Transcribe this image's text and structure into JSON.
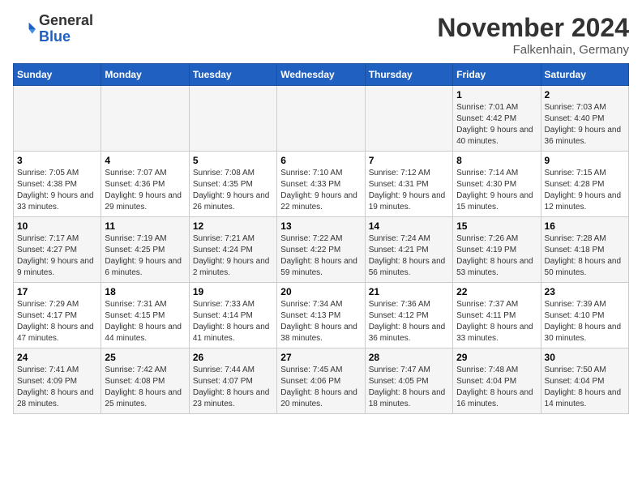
{
  "header": {
    "logo_general": "General",
    "logo_blue": "Blue",
    "month_title": "November 2024",
    "subtitle": "Falkenhain, Germany"
  },
  "columns": [
    "Sunday",
    "Monday",
    "Tuesday",
    "Wednesday",
    "Thursday",
    "Friday",
    "Saturday"
  ],
  "weeks": [
    [
      {
        "day": "",
        "info": ""
      },
      {
        "day": "",
        "info": ""
      },
      {
        "day": "",
        "info": ""
      },
      {
        "day": "",
        "info": ""
      },
      {
        "day": "",
        "info": ""
      },
      {
        "day": "1",
        "info": "Sunrise: 7:01 AM\nSunset: 4:42 PM\nDaylight: 9 hours and 40 minutes."
      },
      {
        "day": "2",
        "info": "Sunrise: 7:03 AM\nSunset: 4:40 PM\nDaylight: 9 hours and 36 minutes."
      }
    ],
    [
      {
        "day": "3",
        "info": "Sunrise: 7:05 AM\nSunset: 4:38 PM\nDaylight: 9 hours and 33 minutes."
      },
      {
        "day": "4",
        "info": "Sunrise: 7:07 AM\nSunset: 4:36 PM\nDaylight: 9 hours and 29 minutes."
      },
      {
        "day": "5",
        "info": "Sunrise: 7:08 AM\nSunset: 4:35 PM\nDaylight: 9 hours and 26 minutes."
      },
      {
        "day": "6",
        "info": "Sunrise: 7:10 AM\nSunset: 4:33 PM\nDaylight: 9 hours and 22 minutes."
      },
      {
        "day": "7",
        "info": "Sunrise: 7:12 AM\nSunset: 4:31 PM\nDaylight: 9 hours and 19 minutes."
      },
      {
        "day": "8",
        "info": "Sunrise: 7:14 AM\nSunset: 4:30 PM\nDaylight: 9 hours and 15 minutes."
      },
      {
        "day": "9",
        "info": "Sunrise: 7:15 AM\nSunset: 4:28 PM\nDaylight: 9 hours and 12 minutes."
      }
    ],
    [
      {
        "day": "10",
        "info": "Sunrise: 7:17 AM\nSunset: 4:27 PM\nDaylight: 9 hours and 9 minutes."
      },
      {
        "day": "11",
        "info": "Sunrise: 7:19 AM\nSunset: 4:25 PM\nDaylight: 9 hours and 6 minutes."
      },
      {
        "day": "12",
        "info": "Sunrise: 7:21 AM\nSunset: 4:24 PM\nDaylight: 9 hours and 2 minutes."
      },
      {
        "day": "13",
        "info": "Sunrise: 7:22 AM\nSunset: 4:22 PM\nDaylight: 8 hours and 59 minutes."
      },
      {
        "day": "14",
        "info": "Sunrise: 7:24 AM\nSunset: 4:21 PM\nDaylight: 8 hours and 56 minutes."
      },
      {
        "day": "15",
        "info": "Sunrise: 7:26 AM\nSunset: 4:19 PM\nDaylight: 8 hours and 53 minutes."
      },
      {
        "day": "16",
        "info": "Sunrise: 7:28 AM\nSunset: 4:18 PM\nDaylight: 8 hours and 50 minutes."
      }
    ],
    [
      {
        "day": "17",
        "info": "Sunrise: 7:29 AM\nSunset: 4:17 PM\nDaylight: 8 hours and 47 minutes."
      },
      {
        "day": "18",
        "info": "Sunrise: 7:31 AM\nSunset: 4:15 PM\nDaylight: 8 hours and 44 minutes."
      },
      {
        "day": "19",
        "info": "Sunrise: 7:33 AM\nSunset: 4:14 PM\nDaylight: 8 hours and 41 minutes."
      },
      {
        "day": "20",
        "info": "Sunrise: 7:34 AM\nSunset: 4:13 PM\nDaylight: 8 hours and 38 minutes."
      },
      {
        "day": "21",
        "info": "Sunrise: 7:36 AM\nSunset: 4:12 PM\nDaylight: 8 hours and 36 minutes."
      },
      {
        "day": "22",
        "info": "Sunrise: 7:37 AM\nSunset: 4:11 PM\nDaylight: 8 hours and 33 minutes."
      },
      {
        "day": "23",
        "info": "Sunrise: 7:39 AM\nSunset: 4:10 PM\nDaylight: 8 hours and 30 minutes."
      }
    ],
    [
      {
        "day": "24",
        "info": "Sunrise: 7:41 AM\nSunset: 4:09 PM\nDaylight: 8 hours and 28 minutes."
      },
      {
        "day": "25",
        "info": "Sunrise: 7:42 AM\nSunset: 4:08 PM\nDaylight: 8 hours and 25 minutes."
      },
      {
        "day": "26",
        "info": "Sunrise: 7:44 AM\nSunset: 4:07 PM\nDaylight: 8 hours and 23 minutes."
      },
      {
        "day": "27",
        "info": "Sunrise: 7:45 AM\nSunset: 4:06 PM\nDaylight: 8 hours and 20 minutes."
      },
      {
        "day": "28",
        "info": "Sunrise: 7:47 AM\nSunset: 4:05 PM\nDaylight: 8 hours and 18 minutes."
      },
      {
        "day": "29",
        "info": "Sunrise: 7:48 AM\nSunset: 4:04 PM\nDaylight: 8 hours and 16 minutes."
      },
      {
        "day": "30",
        "info": "Sunrise: 7:50 AM\nSunset: 4:04 PM\nDaylight: 8 hours and 14 minutes."
      }
    ]
  ]
}
